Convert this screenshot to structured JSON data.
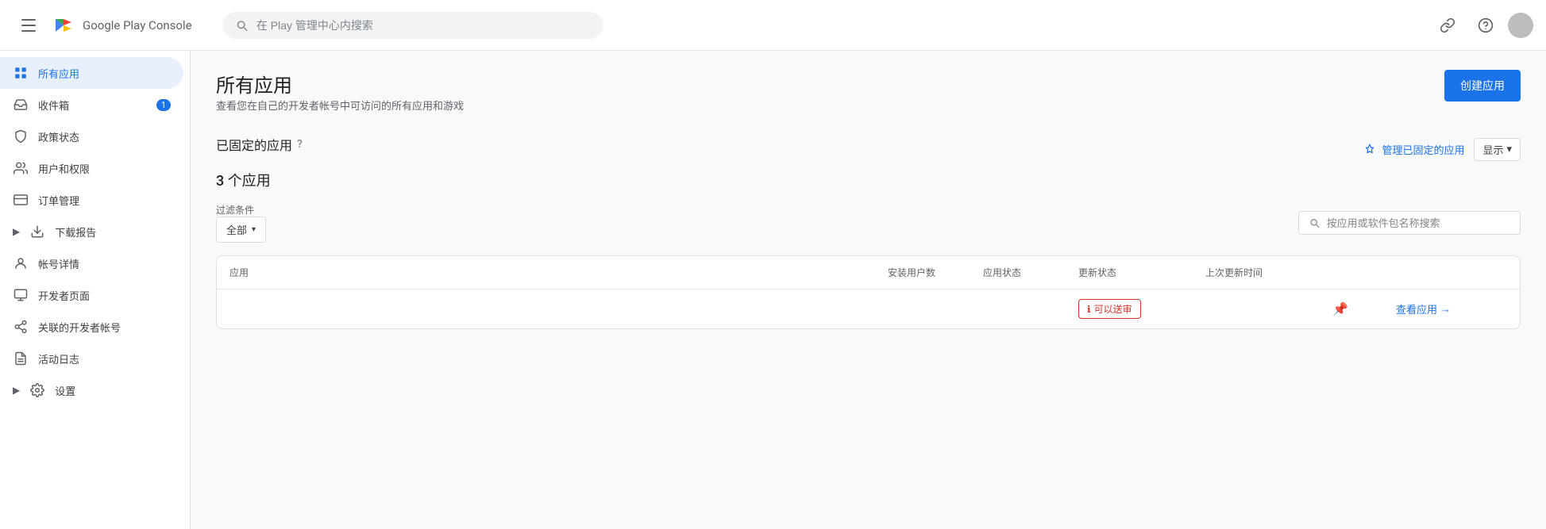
{
  "topbar": {
    "logo_text": "Google Play Console",
    "search_placeholder": "在 Play 管理中心内搜索"
  },
  "sidebar": {
    "items": [
      {
        "id": "all-apps",
        "label": "所有应用",
        "icon": "grid",
        "active": true,
        "badge": null
      },
      {
        "id": "inbox",
        "label": "收件箱",
        "icon": "inbox",
        "active": false,
        "badge": "1"
      },
      {
        "id": "policy",
        "label": "政策状态",
        "icon": "shield",
        "active": false,
        "badge": null
      },
      {
        "id": "users",
        "label": "用户和权限",
        "icon": "users",
        "active": false,
        "badge": null
      },
      {
        "id": "orders",
        "label": "订单管理",
        "icon": "credit-card",
        "active": false,
        "badge": null
      },
      {
        "id": "reports",
        "label": "下载报告",
        "icon": "download",
        "active": false,
        "badge": null,
        "expandable": true
      },
      {
        "id": "account",
        "label": "帐号详情",
        "icon": "account",
        "active": false,
        "badge": null
      },
      {
        "id": "developer-page",
        "label": "开发者页面",
        "icon": "developer",
        "active": false,
        "badge": null
      },
      {
        "id": "linked-accounts",
        "label": "关联的开发者帐号",
        "icon": "link",
        "active": false,
        "badge": null
      },
      {
        "id": "activity-log",
        "label": "活动日志",
        "icon": "log",
        "active": false,
        "badge": null
      },
      {
        "id": "settings",
        "label": "设置",
        "icon": "settings",
        "active": false,
        "badge": null,
        "expandable": true
      }
    ]
  },
  "main": {
    "page_title": "所有应用",
    "page_subtitle": "查看您在自己的开发者帐号中可访问的所有应用和游戏",
    "create_button": "创建应用",
    "pinned_section_title": "已固定的应用",
    "manage_pinned": "管理已固定的应用",
    "show_label": "显示",
    "app_count": "3 个应用",
    "filter_label": "过滤条件",
    "filter_value": "全部",
    "search_placeholder": "按应用或软件包名称搜索",
    "table": {
      "headers": [
        "应用",
        "安装用户数",
        "应用状态",
        "更新状态",
        "上次更新时间",
        "",
        ""
      ],
      "rows": [
        {
          "app_name": "",
          "install_count": "",
          "app_status": "",
          "update_status": "可以送审",
          "update_status_has_border": true,
          "last_updated": "",
          "pin": true,
          "view_link": "查看应用"
        }
      ]
    }
  }
}
